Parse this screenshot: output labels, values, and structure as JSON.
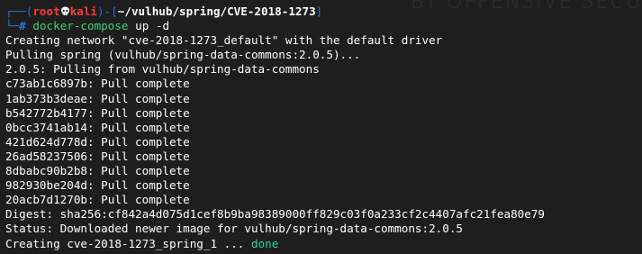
{
  "watermark": "BY OFFENSIVE SECU",
  "prompt": {
    "frame_open": "┌──(",
    "user": "root",
    "host": "kali",
    "frame_mid": ")-[",
    "path": "~/vulhub/spring/CVE-2018-1273",
    "frame_close": "]",
    "second_prefix": "└─",
    "symbol": "#"
  },
  "command": {
    "name": "docker-compose",
    "args": "up -d"
  },
  "output": [
    "Creating network \"cve-2018-1273_default\" with the default driver",
    "Pulling spring (vulhub/spring-data-commons:2.0.5)...",
    "2.0.5: Pulling from vulhub/spring-data-commons",
    "c73ab1c6897b: Pull complete",
    "1ab373b3deae: Pull complete",
    "b542772b4177: Pull complete",
    "0bcc3741ab14: Pull complete",
    "421d624d778d: Pull complete",
    "26ad58237506: Pull complete",
    "8dbabc90b2b8: Pull complete",
    "982930be204d: Pull complete",
    "20acb7d1270b: Pull complete",
    "Digest: sha256:cf842a4d075d1cef8b9ba98389000ff829c03f0a233cf2c4407afc21fea80e79",
    "Status: Downloaded newer image for vulhub/spring-data-commons:2.0.5"
  ],
  "last_line": {
    "text": "Creating cve-2018-1273_spring_1 ... ",
    "status": "done"
  },
  "colors": {
    "background": "#1e1e1e",
    "prompt_frame": "#2f6fd3",
    "user_host": "#ff3b3b",
    "command": "#3bd26e",
    "done": "#2fd4a2"
  }
}
